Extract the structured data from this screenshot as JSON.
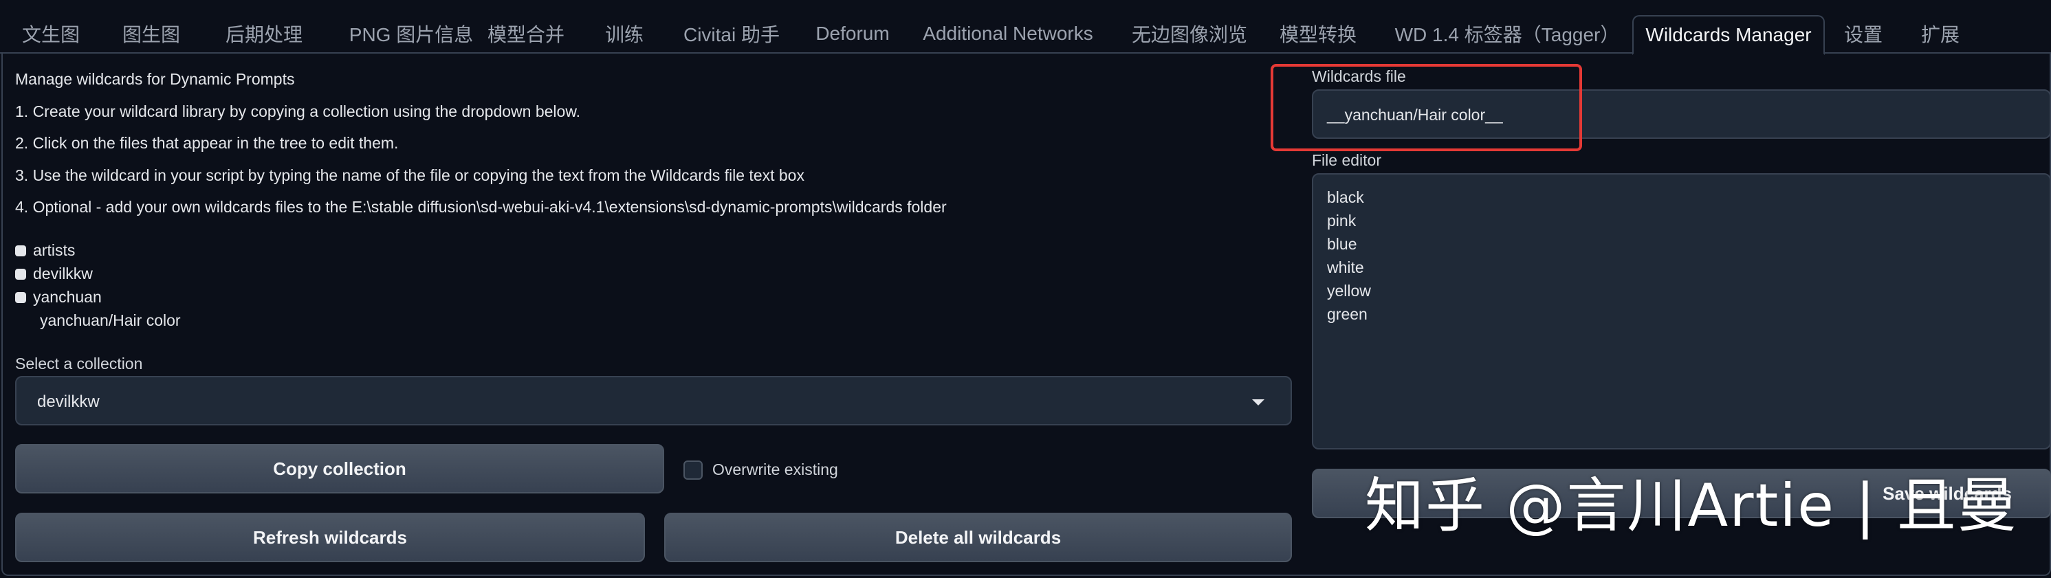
{
  "tabs": [
    {
      "label": "文生图",
      "selected": false
    },
    {
      "label": "图生图",
      "selected": false
    },
    {
      "label": "后期处理",
      "selected": false
    },
    {
      "label": "PNG 图片信息",
      "selected": false
    },
    {
      "label": "模型合并",
      "selected": false
    },
    {
      "label": "训练",
      "selected": false
    },
    {
      "label": "Civitai 助手",
      "selected": false
    },
    {
      "label": "Deforum",
      "selected": false
    },
    {
      "label": "Additional Networks",
      "selected": false
    },
    {
      "label": "无边图像浏览",
      "selected": false
    },
    {
      "label": "模型转换",
      "selected": false
    },
    {
      "label": "WD 1.4 标签器（Tagger）",
      "selected": false
    },
    {
      "label": "Wildcards Manager",
      "selected": true
    },
    {
      "label": "设置",
      "selected": false
    },
    {
      "label": "扩展",
      "selected": false
    }
  ],
  "left": {
    "intro": "Manage wildcards for Dynamic Prompts",
    "steps": [
      "1. Create your wildcard library by copying a collection using the dropdown below.",
      "2. Click on the files that appear in the tree to edit them.",
      "3. Use the wildcard in your script by typing the name of the file or copying the text from the Wildcards file text box",
      "4. Optional - add your own wildcards files to the E:\\stable diffusion\\sd-webui-aki-v4.1\\extensions\\sd-dynamic-prompts\\wildcards folder"
    ],
    "tree": [
      {
        "label": "artists"
      },
      {
        "label": "devilkkw"
      },
      {
        "label": "yanchuan"
      }
    ],
    "tree_child": "yanchuan/Hair color",
    "collection_label": "Select a collection",
    "collection_value": "devilkkw",
    "copy_button": "Copy collection",
    "overwrite_label": "Overwrite existing",
    "refresh_button": "Refresh wildcards",
    "delete_button": "Delete all wildcards"
  },
  "right": {
    "wildcards_file_label": "Wildcards file",
    "wildcards_file_value": "__yanchuan/Hair color__",
    "file_editor_label": "File editor",
    "file_lines": [
      "black",
      "pink",
      "blue",
      "white",
      "yellow",
      "green"
    ],
    "save_button": "Save wildcards"
  },
  "watermark": "知乎 @言川Artie | 且曼",
  "colors": {
    "background": "#0b0f19",
    "panel": "#1f2937",
    "border": "#374151",
    "button": "#4b5563",
    "highlight": "#e53935"
  }
}
